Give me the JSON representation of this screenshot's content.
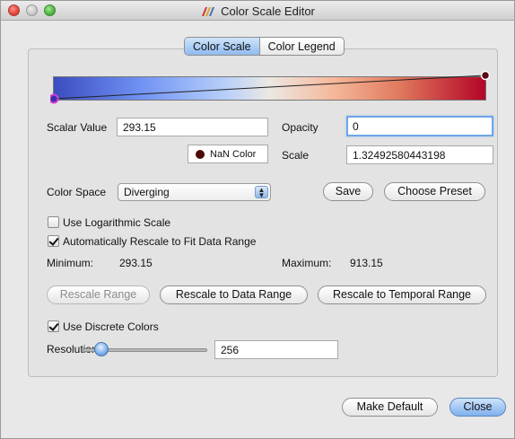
{
  "window": {
    "title": "Color Scale Editor",
    "app_icon": "paraview-icon"
  },
  "tabs": [
    {
      "label": "Color Scale",
      "active": true
    },
    {
      "label": "Color Legend",
      "active": false
    }
  ],
  "scalar": {
    "label": "Scalar Value",
    "value": "293.15"
  },
  "opacity": {
    "label": "Opacity",
    "value": "0"
  },
  "nan_color": {
    "label": "NaN Color",
    "color": "#4a0a06"
  },
  "scale": {
    "label": "Scale",
    "value": "1.32492580443198"
  },
  "color_space": {
    "label": "Color Space",
    "value": "Diverging"
  },
  "buttons": {
    "save": "Save",
    "choose_preset": "Choose Preset",
    "rescale_range": "Rescale Range",
    "rescale_data": "Rescale to Data Range",
    "rescale_temporal": "Rescale to Temporal Range",
    "make_default": "Make Default",
    "close": "Close"
  },
  "checkboxes": {
    "log_scale": {
      "label": "Use Logarithmic Scale",
      "checked": false
    },
    "auto_rescale": {
      "label": "Automatically Rescale to Fit Data Range",
      "checked": true
    },
    "discrete": {
      "label": "Use Discrete Colors",
      "checked": true
    }
  },
  "range": {
    "min_label": "Minimum:",
    "min_value": "293.15",
    "max_label": "Maximum:",
    "max_value": "913.15"
  },
  "resolution": {
    "label": "Resolution",
    "value": "256"
  },
  "colors": {
    "gradient_low": "#3b4cc0",
    "gradient_mid": "#ece8e3",
    "gradient_high": "#b40426",
    "accent": "#7fb0ec"
  }
}
